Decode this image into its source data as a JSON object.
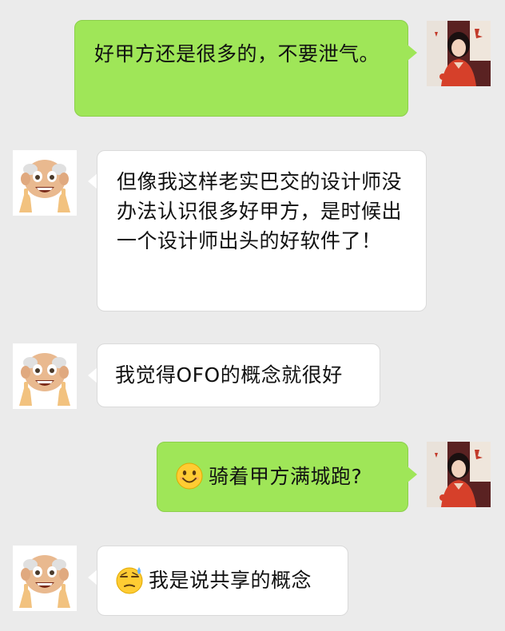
{
  "messages": [
    {
      "side": "sent",
      "text": "好甲方还是很多的，不要泄气。"
    },
    {
      "side": "received",
      "text": "但像我这样老实巴交的设计师没办法认识很多好甲方，是时候出一个设计师出头的好软件了！"
    },
    {
      "side": "received",
      "text": "我觉得OFO的概念就很好"
    },
    {
      "side": "sent",
      "emoji": "smiling-face-emoji",
      "text": "骑着甲方满城跑?"
    },
    {
      "side": "received",
      "emoji": "sweat-face-emoji",
      "text": "我是说共享的概念"
    }
  ],
  "avatars": {
    "sent": "girl-avatar",
    "received": "old-man-emoji-avatar"
  },
  "colors": {
    "background": "#ebebeb",
    "sent_bubble": "#9fe658",
    "received_bubble": "#ffffff"
  }
}
